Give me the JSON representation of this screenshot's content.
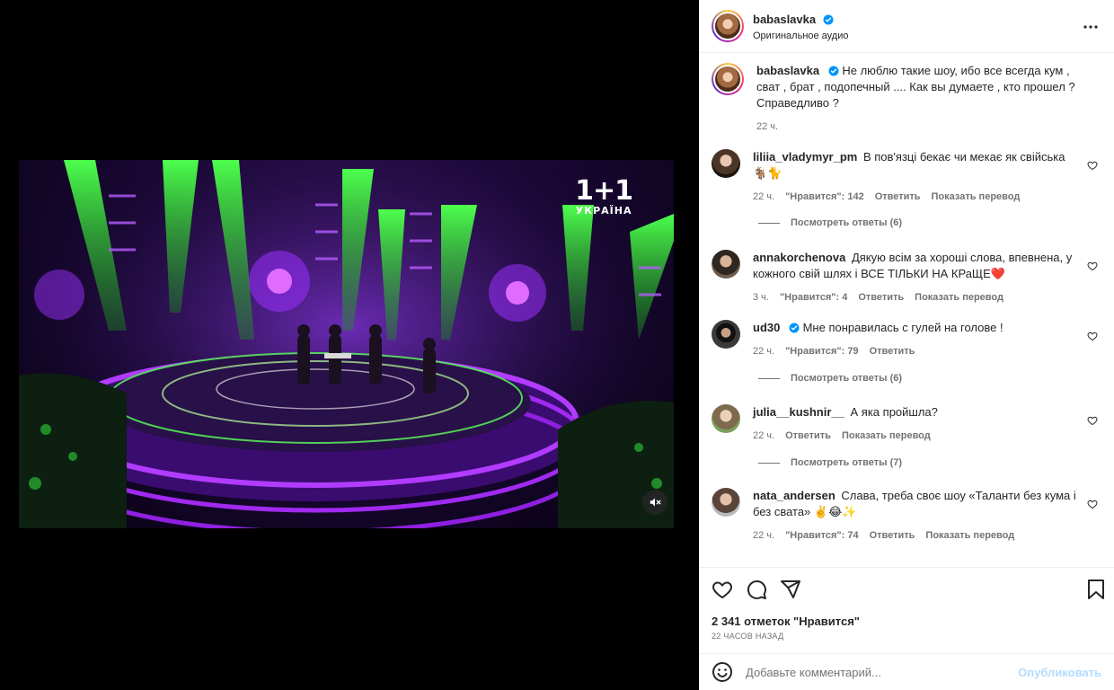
{
  "post": {
    "username": "babaslavka",
    "audio": "Оригинальное аудио"
  },
  "video": {
    "logo_main": "1+1",
    "logo_sub": "УКРАЇНА"
  },
  "caption": {
    "username": "babaslavka",
    "text": "Не люблю такие шоу, ибо все всегда кум , сват , брат , подопечный .... Как вы думаете , кто прошел ? Справедливо ?",
    "time": "22 ч."
  },
  "comments": [
    {
      "username": "liliia_vladymyr_pm",
      "text": "В пов'язці бекає чи мекає як свійська 🐐🐈",
      "time": "22 ч.",
      "likes": "\"Нравится\": 142",
      "reply": "Ответить",
      "translate": "Показать перевод",
      "replies": "Посмотреть ответы (6)"
    },
    {
      "username": "annakorchenova",
      "text": "Дякую всім за хороші слова, впевнена, у кожного свій шлях і ВСЕ ТІЛЬКИ НА КРаЩЕ❤️",
      "time": "3 ч.",
      "likes": "\"Нравится\": 4",
      "reply": "Ответить",
      "translate": "Показать перевод"
    },
    {
      "username": "ud30",
      "text": "Мне понравилась с гулей на голове !",
      "time": "22 ч.",
      "likes": "\"Нравится\": 79",
      "reply": "Ответить",
      "replies": "Посмотреть ответы (6)"
    },
    {
      "username": "julia__kushnir__",
      "text": "А яка пройшла?",
      "time": "22 ч.",
      "reply": "Ответить",
      "translate": "Показать перевод",
      "replies": "Посмотреть ответы (7)"
    },
    {
      "username": "nata_andersen",
      "text": "Слава, треба своє шоу «Таланти без кума і без свата» ✌️😂✨",
      "time": "22 ч.",
      "likes": "\"Нравится\": 74",
      "reply": "Ответить",
      "translate": "Показать перевод"
    }
  ],
  "footer": {
    "likes": "2 341 отметок \"Нравится\"",
    "date": "22 ЧАСОВ НАЗАД",
    "placeholder": "Добавьте комментарий...",
    "publish": "Опубликовать"
  },
  "colors": {
    "verified": "#0095f6",
    "text": "#262626",
    "muted": "#737373",
    "publish_disabled": "#b3dbff"
  }
}
